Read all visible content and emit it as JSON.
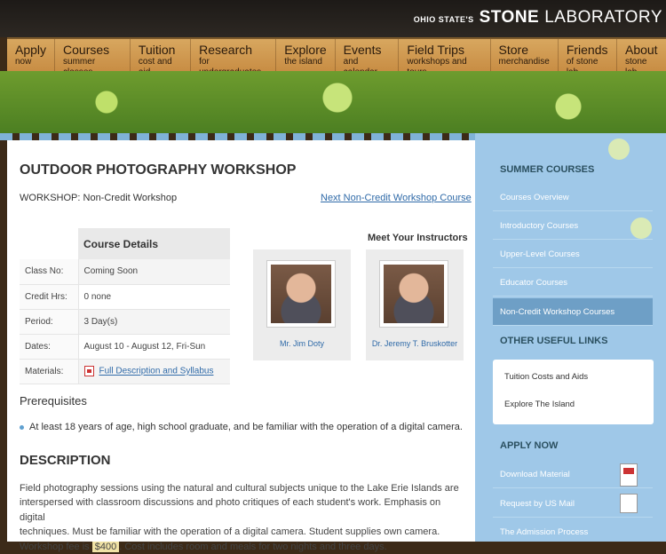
{
  "brand": {
    "prefix": "OHIO STATE'S",
    "name_bold": "STONE",
    "name_rest": "LABORATORY"
  },
  "nav": [
    {
      "title": "Apply",
      "sub": "now"
    },
    {
      "title": "Courses",
      "sub": "summer classes"
    },
    {
      "title": "Tuition",
      "sub": "cost and aid"
    },
    {
      "title": "Research",
      "sub": "for undergraduates"
    },
    {
      "title": "Explore",
      "sub": "the island"
    },
    {
      "title": "Events",
      "sub": "and calendar"
    },
    {
      "title": "Field Trips",
      "sub": "workshops and tours"
    },
    {
      "title": "Store",
      "sub": "merchandise"
    },
    {
      "title": "Friends",
      "sub": "of stone lab"
    },
    {
      "title": "About",
      "sub": "stone lab"
    }
  ],
  "page": {
    "title": "OUTDOOR PHOTOGRAPHY WORKSHOP",
    "workshop_line": "WORKSHOP: Non-Credit Workshop",
    "next_link": "Next Non-Credit Workshop Course"
  },
  "course_details": {
    "header": "Course Details",
    "rows": [
      {
        "label": "Class No:",
        "value": "Coming Soon"
      },
      {
        "label": "Credit Hrs:",
        "value": "0 none"
      },
      {
        "label": "Period:",
        "value": "3 Day(s)"
      },
      {
        "label": "Dates:",
        "value": "August 10 - August 12, Fri-Sun"
      },
      {
        "label": "Materials:",
        "value": "Full Description and Syllabus"
      }
    ]
  },
  "instructors": {
    "heading": "Meet Your Instructors",
    "people": [
      {
        "name": "Mr. Jim Doty"
      },
      {
        "name": "Dr. Jeremy T. Bruskotter"
      }
    ]
  },
  "prerequisites": {
    "heading": "Prerequisites",
    "items": [
      "At least 18 years of age, high school graduate, and be familiar with the operation of a digital camera."
    ]
  },
  "description": {
    "heading": "DESCRIPTION",
    "line1": "Field photography sessions using the natural and cultural subjects unique to the Lake Erie Islands are",
    "line2": "interspersed with classroom discussions and photo critiques of each student's work. Emphasis on digital",
    "line3": "techniques. Must be familiar with the operation of a digital camera. Student supplies own camera.",
    "line4_pre": "Workshop fee is",
    "fee": "$400",
    "line4_post": ". Cost includes room and meals for two nights and three days."
  },
  "sidebar": {
    "summer_heading": "SUMMER COURSES",
    "summer_items": [
      "Courses Overview",
      "Introductory Courses",
      "Upper-Level Courses",
      "Educator Courses",
      "Non-Credit Workshop Courses"
    ],
    "active_index": 4,
    "useful_heading": "OTHER USEFUL LINKS",
    "useful_items": [
      "Tuition Costs and Aids",
      "Explore The Island"
    ],
    "apply_heading": "APPLY NOW",
    "apply_items": [
      "Download Material",
      "Request by US Mail",
      "The Admission Process"
    ]
  },
  "colors": {
    "nav_tan": "#d8a75f",
    "sidebar_blue": "#9fc8e8",
    "link_blue": "#2f6aa8",
    "banner_green": "#5e8f28"
  }
}
